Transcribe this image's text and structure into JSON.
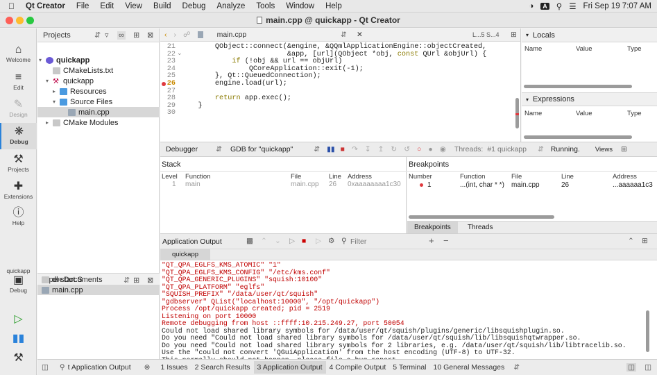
{
  "menubar": {
    "app": "Qt Creator",
    "items": [
      "File",
      "Edit",
      "View",
      "Build",
      "Debug",
      "Analyze",
      "Tools",
      "Window",
      "Help"
    ],
    "clock": "Fri Sep 19  7:07 AM",
    "input_label": "A"
  },
  "window": {
    "title": "main.cpp @ quickapp - Qt Creator"
  },
  "modes": [
    {
      "label": "Welcome",
      "icon": "home-icon"
    },
    {
      "label": "Edit",
      "icon": "edit-lines-icon"
    },
    {
      "label": "Design",
      "icon": "pen-icon"
    },
    {
      "label": "Debug",
      "icon": "bug-icon"
    },
    {
      "label": "Projects",
      "icon": "wrench-icon"
    },
    {
      "label": "Extensions",
      "icon": "extensions-icon"
    },
    {
      "label": "Help",
      "icon": "help-icon"
    }
  ],
  "kit": {
    "project": "quickapp",
    "mode": "Debug"
  },
  "projects": {
    "header": "Projects",
    "tree": [
      {
        "label": "quickapp",
        "level": 0,
        "bold": true
      },
      {
        "label": "CMakeLists.txt",
        "level": 1
      },
      {
        "label": "quickapp",
        "level": 1
      },
      {
        "label": "Resources",
        "level": 2
      },
      {
        "label": "Source Files",
        "level": 2
      },
      {
        "label": "main.cpp",
        "level": 3,
        "selected": true
      },
      {
        "label": "CMake Modules",
        "level": 1
      }
    ]
  },
  "open_docs": {
    "header": "Open Documents",
    "items": [
      "dl-start.S",
      "main.cpp"
    ]
  },
  "editor": {
    "file": "main.cpp",
    "symbol_info": "L...5  S...4",
    "lines": [
      {
        "n": "21",
        "text": "        QObject::connect(&engine, &QQmlApplicationEngine::objectCreated,"
      },
      {
        "n": "22",
        "text": "                         &app, [url](QObject *obj, const QUrl &objUrl) {"
      },
      {
        "n": "23",
        "text": "            if (!obj && url == objUrl)"
      },
      {
        "n": "24",
        "text": "                QCoreApplication::exit(-1);"
      },
      {
        "n": "25",
        "text": "        }, Qt::QueuedConnection);"
      },
      {
        "n": "26",
        "text": "        engine.load(url);"
      },
      {
        "n": "27",
        "text": ""
      },
      {
        "n": "28",
        "text": "        return app.exec();"
      },
      {
        "n": "29",
        "text": "    }"
      },
      {
        "n": "30",
        "text": ""
      }
    ]
  },
  "locals": {
    "header": "Locals",
    "cols": [
      "Name",
      "Value",
      "Type"
    ]
  },
  "expressions": {
    "header": "Expressions",
    "cols": [
      "Name",
      "Value",
      "Type"
    ]
  },
  "debugbar": {
    "debugger_label": "Debugger",
    "engine": "GDB for \"quickapp\"",
    "threads_label": "Threads:",
    "thread": "#1 quickapp",
    "status": "Running.",
    "views": "Views"
  },
  "stack": {
    "header": "Stack",
    "cols": [
      "Level",
      "Function",
      "File",
      "Line",
      "Address"
    ],
    "rows": [
      {
        "level": "1",
        "function": "main",
        "file": "main.cpp",
        "line": "26",
        "address": "0xaaaaaaaa1c30"
      }
    ]
  },
  "breakpoints": {
    "header": "Breakpoints",
    "cols": [
      "Number",
      "Function",
      "File",
      "Line",
      "Address"
    ],
    "rows": [
      {
        "number": "1",
        "function": "...(int, char * *)",
        "file": "main.cpp",
        "line": "26",
        "address": "...aaaaaa1c3"
      }
    ],
    "tabs": [
      "Breakpoints",
      "Threads"
    ]
  },
  "app_output": {
    "header": "Application Output",
    "filter_placeholder": "Filter",
    "tab": "quickapp",
    "lines": [
      {
        "text": "\"QT_QPA_EGLFS_KMS_ATOMIC\" \"1\"",
        "red": true
      },
      {
        "text": "\"QT_QPA_EGLFS_KMS_CONFIG\" \"/etc/kms.conf\"",
        "red": true
      },
      {
        "text": "\"QT_QPA_GENERIC_PLUGINS\" \"squish:10100\"",
        "red": true
      },
      {
        "text": "\"QT_QPA_PLATFORM\" \"eglfs\"",
        "red": true
      },
      {
        "text": "\"SQUISH_PREFIX\" \"/data/user/qt/squish\"",
        "red": true
      },
      {
        "text": "\"gdbserver\" QList(\"localhost:10000\", \"/opt/quickapp\")",
        "red": true
      },
      {
        "text": "Process /opt/quickapp created; pid = 2519",
        "red": true
      },
      {
        "text": "Listening on port 10000",
        "red": true
      },
      {
        "text": "Remote debugging from host ::ffff:10.215.249.27, port 50054",
        "red": true
      },
      {
        "text": "Could not load shared library symbols for /data/user/qt/squish/plugins/generic/libsquishplugin.so.",
        "red": false
      },
      {
        "text": "Do you need \"Could not load shared library symbols for /data/user/qt/squish/lib/libsquishqtwrapper.so.",
        "red": false
      },
      {
        "text": "Do you need \"Could not load shared library symbols for 2 libraries, e.g. /data/user/qt/squish/lib/libtracelib.so.",
        "red": false
      },
      {
        "text": "Use the \"could not convert 'QGuiApplication' from the host encoding (UTF-8) to UTF-32.",
        "red": false
      },
      {
        "text": "This normally should not happen, please file a bug report.",
        "red": false
      }
    ]
  },
  "bottom": {
    "search_value": "t Application Output",
    "tabs": [
      {
        "n": "1",
        "label": "Issues"
      },
      {
        "n": "2",
        "label": "Search Results"
      },
      {
        "n": "3",
        "label": "Application Output",
        "active": true
      },
      {
        "n": "4",
        "label": "Compile Output"
      },
      {
        "n": "5",
        "label": "Terminal"
      },
      {
        "n": "10",
        "label": "General Messages"
      }
    ]
  },
  "colors": {
    "accent": "#2a82da",
    "error_text": "#c00000",
    "breakpoint": "#e0393e"
  }
}
